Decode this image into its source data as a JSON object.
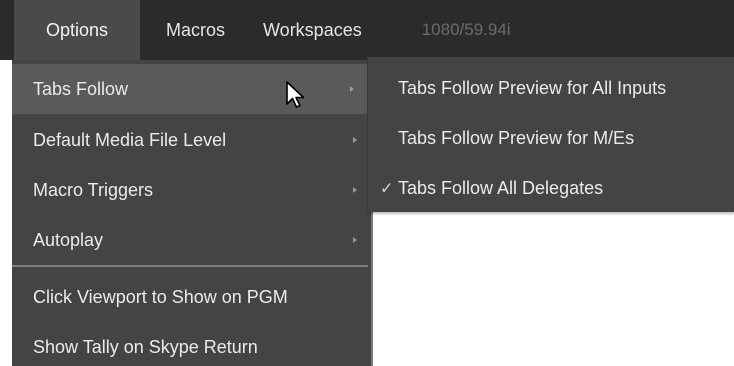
{
  "menubar": {
    "items": [
      {
        "label": "Options"
      },
      {
        "label": "Macros"
      },
      {
        "label": "Workspaces"
      }
    ],
    "status": "1080/59.94i"
  },
  "options_menu": {
    "items": [
      {
        "label": "Tabs Follow",
        "has_submenu": true,
        "highlighted": true
      },
      {
        "label": "Default Media File Level",
        "has_submenu": true
      },
      {
        "label": "Macro Triggers",
        "has_submenu": true
      },
      {
        "label": "Autoplay",
        "has_submenu": true
      },
      {
        "label": "Click Viewport to Show on PGM",
        "has_submenu": false
      },
      {
        "label": "Show Tally on Skype Return",
        "has_submenu": false
      }
    ]
  },
  "tabs_follow_submenu": {
    "items": [
      {
        "label": "Tabs Follow Preview for All Inputs",
        "checked": false
      },
      {
        "label": "Tabs Follow Preview for M/Es",
        "checked": false
      },
      {
        "label": "Tabs Follow All Delegates",
        "checked": true
      }
    ],
    "check_glyph": "✓"
  },
  "icons": {
    "submenu_arrow": "triangle-right-icon",
    "cursor": "mouse-pointer-icon",
    "check": "checkmark-icon"
  },
  "colors": {
    "menubar_bg": "#2b2b2b",
    "menu_bg": "#444444",
    "highlight_bg": "#5a5a5a",
    "text": "#ebebeb",
    "status_text": "#6b6b6b"
  }
}
